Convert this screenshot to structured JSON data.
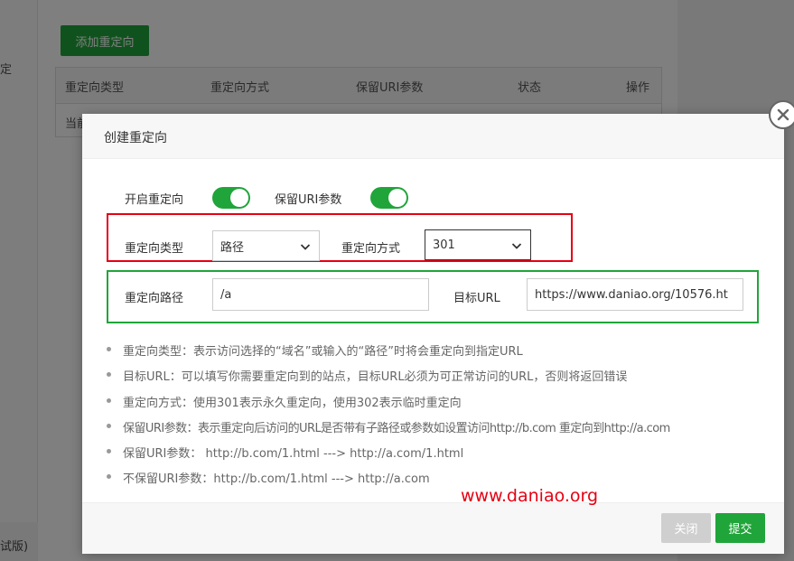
{
  "background": {
    "add_button": "添加重定向",
    "table_headers": [
      "重定向类型",
      "重定向方式",
      "保留URI参数",
      "状态",
      "操作"
    ],
    "row_text": "当前",
    "left_char": "定",
    "bottom_text": "试版)"
  },
  "modal": {
    "title": "创建重定向",
    "enable_redirect_label": "开启重定向",
    "enable_redirect_on": true,
    "keep_uri_label": "保留URI参数",
    "keep_uri_on": true,
    "redirect_type_label": "重定向类型",
    "redirect_type_value": "路径",
    "redirect_method_label": "重定向方式",
    "redirect_method_value": "301",
    "redirect_path_label": "重定向路径",
    "redirect_path_value": "/a",
    "target_url_label": "目标URL",
    "target_url_value": "https://www.daniao.org/10576.ht",
    "tips": [
      "重定向类型：表示访问选择的“域名”或输入的“路径”时将会重定向到指定URL",
      "目标URL：可以填写你需要重定向到的站点，目标URL必须为可正常访问的URL，否则将返回错误",
      "重定向方式：使用301表示永久重定向，使用302表示临时重定向",
      "保留URI参数：表示重定向后访问的URL是否带有子路径或参数如设置访问http://b.com 重定向到http://a.com",
      "保留URI参数：  http://b.com/1.html ---> http://a.com/1.html",
      "不保留URI参数：http://b.com/1.html ---> http://a.com"
    ],
    "close_button": "关闭",
    "submit_button": "提交"
  },
  "watermark": "www.daniao.org",
  "colors": {
    "accent": "#20a53a",
    "highlight_red": "#e60012"
  }
}
